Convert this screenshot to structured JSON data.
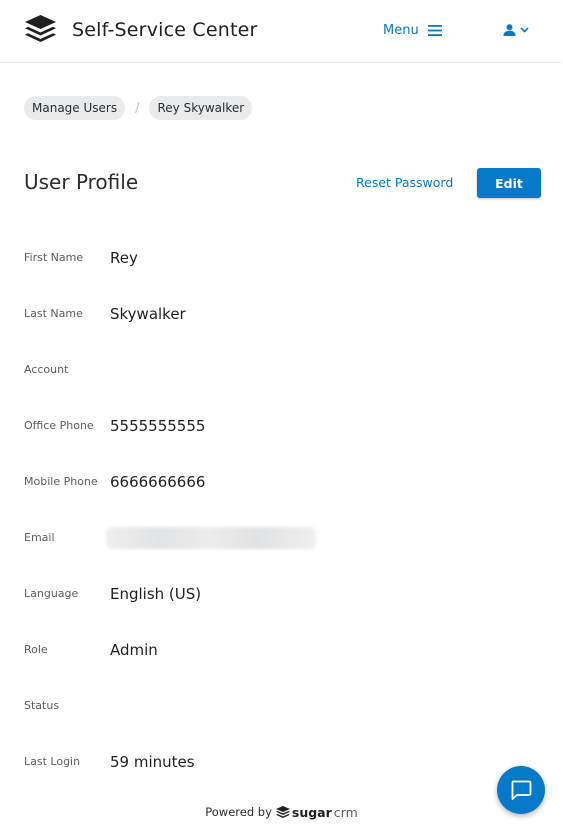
{
  "header": {
    "app_title": "Self-Service Center",
    "menu_label": "Menu",
    "logo_icon": "stack-layers-icon",
    "user_icon": "user-icon",
    "user_chevron_icon": "chevron-down-icon",
    "accent_color": "#0679c8"
  },
  "breadcrumb": {
    "items": [
      {
        "label": "Manage Users"
      },
      {
        "label": "Rey Skywalker"
      }
    ],
    "separator": "/"
  },
  "profile": {
    "title": "User Profile",
    "reset_password_label": "Reset Password",
    "edit_label": "Edit"
  },
  "fields": [
    {
      "label": "First Name",
      "value": "Rey"
    },
    {
      "label": "Last Name",
      "value": "Skywalker"
    },
    {
      "label": "Account",
      "value": ""
    },
    {
      "label": "Office Phone",
      "value": "5555555555"
    },
    {
      "label": "Mobile Phone",
      "value": "6666666666"
    },
    {
      "label": "Email",
      "value": "",
      "redacted": true
    },
    {
      "label": "Language",
      "value": "English (US)"
    },
    {
      "label": "Role",
      "value": "Admin"
    },
    {
      "label": "Status",
      "value": ""
    },
    {
      "label": "Last Login",
      "value": "59 minutes"
    }
  ],
  "footer": {
    "powered_by": "Powered by",
    "brand_sugar": "sugar",
    "brand_crm": "crm"
  },
  "chat": {
    "icon": "chat-bubble-icon"
  }
}
